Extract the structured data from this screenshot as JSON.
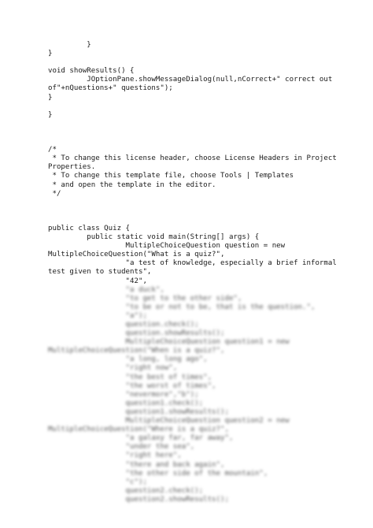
{
  "document": {
    "lines": [
      {
        "text": "         }",
        "blurred": false
      },
      {
        "text": "}",
        "blurred": false
      },
      {
        "text": "",
        "blurred": false
      },
      {
        "text": "void showResults() {",
        "blurred": false
      },
      {
        "text": "         JOptionPane.showMessageDialog(null,nCorrect+\" correct out",
        "blurred": false
      },
      {
        "text": "of\"+nQuestions+\" questions\");",
        "blurred": false
      },
      {
        "text": "}",
        "blurred": false
      },
      {
        "text": "",
        "blurred": false
      },
      {
        "text": "}",
        "blurred": false
      },
      {
        "text": "",
        "blurred": false
      },
      {
        "text": "",
        "blurred": false
      },
      {
        "text": "",
        "blurred": false
      },
      {
        "text": "/*",
        "blurred": false
      },
      {
        "text": " * To change this license header, choose License Headers in Project",
        "blurred": false
      },
      {
        "text": "Properties.",
        "blurred": false
      },
      {
        "text": " * To change this template file, choose Tools | Templates",
        "blurred": false
      },
      {
        "text": " * and open the template in the editor.",
        "blurred": false
      },
      {
        "text": " */",
        "blurred": false
      },
      {
        "text": "",
        "blurred": false
      },
      {
        "text": "",
        "blurred": false
      },
      {
        "text": "",
        "blurred": false
      },
      {
        "text": "public class Quiz {",
        "blurred": false
      },
      {
        "text": "         public static void main(String[] args) {",
        "blurred": false
      },
      {
        "text": "                  MultipleChoiceQuestion question = new",
        "blurred": false
      },
      {
        "text": "MultipleChoiceQuestion(\"What is a quiz?\",",
        "blurred": false
      },
      {
        "text": "                  \"a test of knowledge, especially a brief informal",
        "blurred": false
      },
      {
        "text": "test given to students\",",
        "blurred": false
      },
      {
        "text": "                  \"42\",",
        "blurred": false
      },
      {
        "text": "                  \"a duck\",",
        "blurred": true
      },
      {
        "text": "                  \"to get to the other side\",",
        "blurred": true
      },
      {
        "text": "                  \"to be or not to be, that is the question.\",",
        "blurred": true
      },
      {
        "text": "                  \"a\");",
        "blurred": true
      },
      {
        "text": "                  question.check();",
        "blurred": true
      },
      {
        "text": "                  question.showResults();",
        "blurred": true
      },
      {
        "text": "                  MultipleChoiceQuestion question1 = new",
        "blurred": true
      },
      {
        "text": "MultipleChoiceQuestion(\"When is a quiz?\",",
        "blurred": true
      },
      {
        "text": "                  \"a long, long ago\",",
        "blurred": true
      },
      {
        "text": "                  \"right now\",",
        "blurred": true
      },
      {
        "text": "                  \"the best of times\",",
        "blurred": true
      },
      {
        "text": "                  \"the worst of times\",",
        "blurred": true
      },
      {
        "text": "                  \"nevermore\",\"b\");",
        "blurred": true
      },
      {
        "text": "                  question1.check();",
        "blurred": true
      },
      {
        "text": "                  question1.showResults();",
        "blurred": true
      },
      {
        "text": "                  MultipleChoiceQuestion question2 = new",
        "blurred": true
      },
      {
        "text": "MultipleChoiceQuestion(\"Where is a quiz?\",",
        "blurred": true
      },
      {
        "text": "                  \"a galaxy far, far away\",",
        "blurred": true
      },
      {
        "text": "                  \"under the sea\",",
        "blurred": true
      },
      {
        "text": "                  \"right here\",",
        "blurred": true
      },
      {
        "text": "                  \"there and back again\",",
        "blurred": true
      },
      {
        "text": "                  \"the other side of the mountain\",",
        "blurred": true
      },
      {
        "text": "                  \"c\");",
        "blurred": true
      },
      {
        "text": "                  question2.check();",
        "blurred": true
      },
      {
        "text": "                  question2.showResults();",
        "blurred": true
      }
    ]
  }
}
